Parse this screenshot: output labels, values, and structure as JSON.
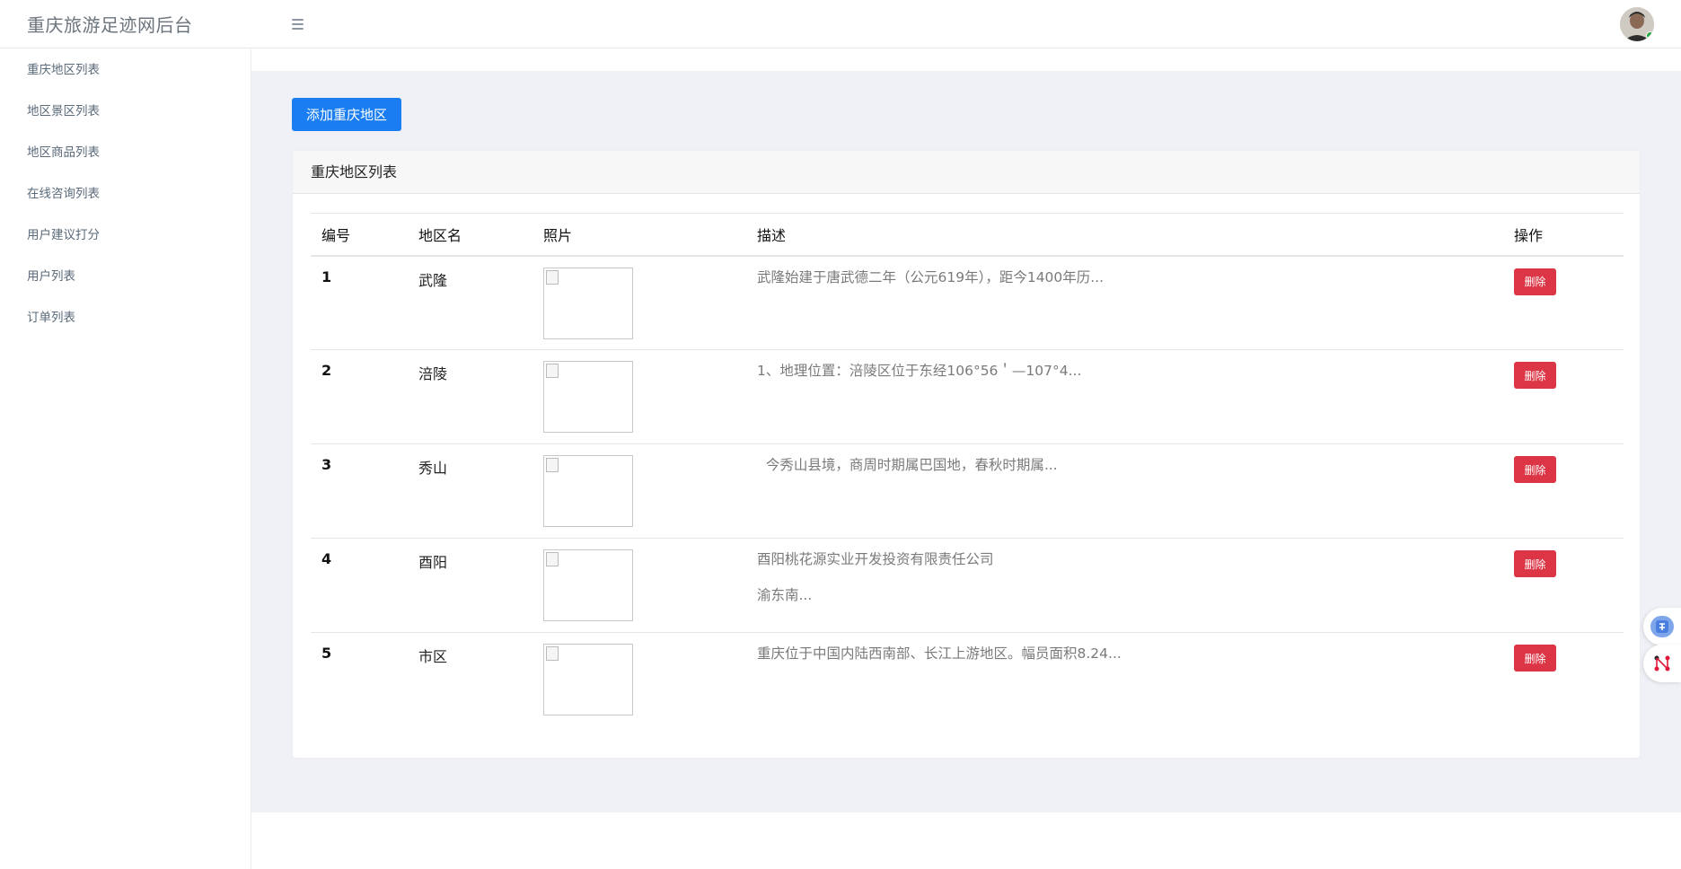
{
  "header": {
    "brand": "重庆旅游足迹网后台"
  },
  "sidebar": {
    "items": [
      {
        "label": "重庆地区列表"
      },
      {
        "label": "地区景区列表"
      },
      {
        "label": "地区商品列表"
      },
      {
        "label": "在线咨询列表"
      },
      {
        "label": "用户建议打分"
      },
      {
        "label": "用户列表"
      },
      {
        "label": "订单列表"
      }
    ]
  },
  "main": {
    "add_button": "添加重庆地区",
    "card_title": "重庆地区列表",
    "table": {
      "columns": [
        "编号",
        "地区名",
        "照片",
        "描述",
        "操作"
      ],
      "rows": [
        {
          "id": "1",
          "name": "武隆",
          "desc": "武隆始建于唐武德二年（公元619年），距今1400年历...",
          "desc2": "",
          "action": "删除"
        },
        {
          "id": "2",
          "name": "涪陵",
          "desc": "1、地理位置：涪陵区位于东经106°56＇—107°4...",
          "desc2": "",
          "action": "删除"
        },
        {
          "id": "3",
          "name": "秀山",
          "desc": "  今秀山县境，商周时期属巴国地，春秋时期属...",
          "desc2": "",
          "action": "删除"
        },
        {
          "id": "4",
          "name": "酉阳",
          "desc": "酉阳桃花源实业开发投资有限责任公司",
          "desc2": "渝东南...",
          "action": "删除"
        },
        {
          "id": "5",
          "name": "市区",
          "desc": "重庆位于中国内陆西南部、长江上游地区。幅员面积8.24...",
          "desc2": "",
          "action": "删除"
        }
      ]
    }
  },
  "colors": {
    "primary": "#1a7df2",
    "danger": "#dc3545",
    "content_bg": "#eff1f6",
    "online": "#28a745"
  },
  "icons": {
    "menu": "hamburger-menu-icon",
    "avatar": "user-avatar",
    "translate": "translate-icon",
    "network": "network-icon"
  }
}
